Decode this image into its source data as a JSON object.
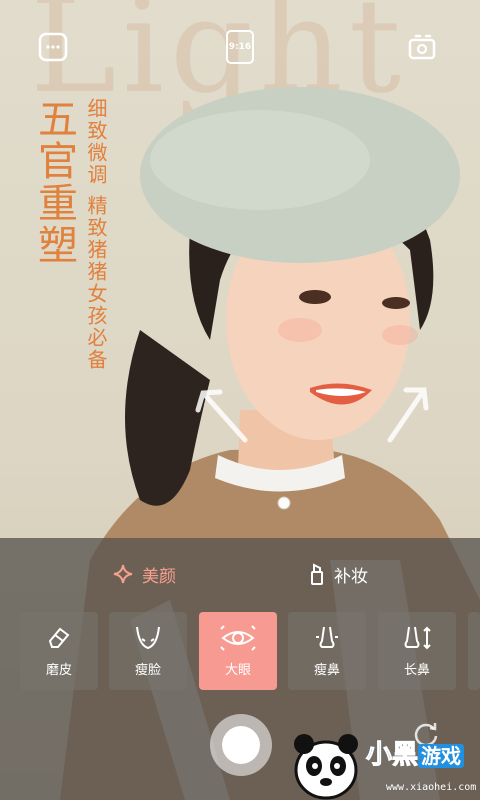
{
  "background_watermark": "Light",
  "top_bar": {
    "menu_icon": "more-dots-icon",
    "ratio_label": "9:16",
    "switch_icon": "camera-switch-icon"
  },
  "promo": {
    "headline": "五官重塑",
    "line1": "细致微调",
    "line2": "精致猪猪女孩必备"
  },
  "tabs": [
    {
      "label": "美颜",
      "icon": "sparkle-diamond-icon",
      "active": true
    },
    {
      "label": "补妆",
      "icon": "lipstick-icon",
      "active": false
    }
  ],
  "tools": [
    {
      "label": "磨皮",
      "icon": "eraser-icon"
    },
    {
      "label": "瘦脸",
      "icon": "face-slim-icon"
    },
    {
      "label": "大眼",
      "icon": "eye-icon",
      "active": true
    },
    {
      "label": "瘦鼻",
      "icon": "nose-slim-icon"
    },
    {
      "label": "长鼻",
      "icon": "nose-long-icon"
    }
  ],
  "brand": {
    "name_main": "小黑",
    "name_tag": "游戏",
    "url": "www.xiaohei.com"
  },
  "colors": {
    "accent": "#f79b92",
    "promo_orange": "#e0813e",
    "panel": "#58544f"
  }
}
